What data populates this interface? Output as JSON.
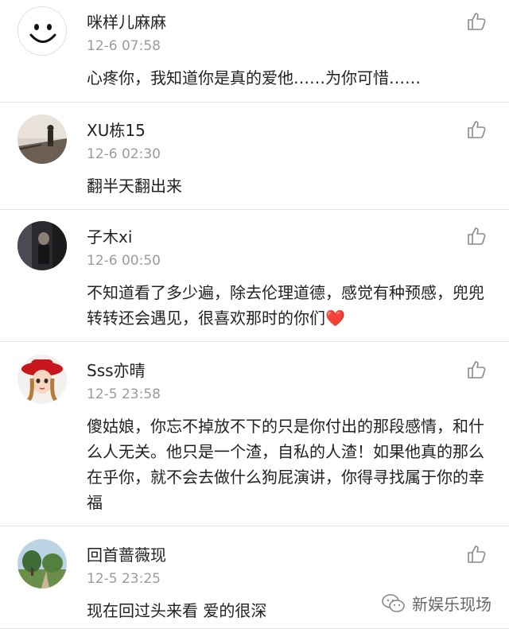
{
  "comments": [
    {
      "username": "咪样儿麻麻",
      "time": "12-6 07:58",
      "text": "心疼你，我知道你是真的爱他……为你可惜……",
      "avatar_icon": "smiley-face-avatar"
    },
    {
      "username": "XU栋15",
      "time": "12-6 02:30",
      "text": "翻半天翻出来",
      "avatar_icon": "person-on-bridge-photo-avatar"
    },
    {
      "username": "子木xi",
      "time": "12-6 00:50",
      "text": "不知道看了多少遍，除去伦理道德，感觉有种预感，兜兜转转还会遇见，很喜欢那时的你们",
      "emoji": "❤️",
      "avatar_icon": "dark-portrait-photo-avatar"
    },
    {
      "username": "Sss亦晴",
      "time": "12-5 23:58",
      "text": "傻姑娘，你忘不掉放不下的只是你付出的那段感情，和什么人无关。他只是一个渣，自私的人渣！如果他真的那么在乎你，就不会去做什么狗屁演讲，你得寻找属于你的幸福",
      "avatar_icon": "cartoon-girl-red-hat-avatar"
    },
    {
      "username": "回首蔷薇现",
      "time": "12-5 23:25",
      "text": "现在回过头来看 爱的很深",
      "avatar_icon": "landscape-trees-photo-avatar"
    }
  ],
  "watermark": {
    "text": "新娱乐现场",
    "icon": "wechat-icon"
  },
  "like_icon": "thumbs-up-icon",
  "colors": {
    "text": "#222222",
    "meta": "#9b9b9b",
    "divider": "#e6e6e6",
    "heart": "#e53935"
  }
}
